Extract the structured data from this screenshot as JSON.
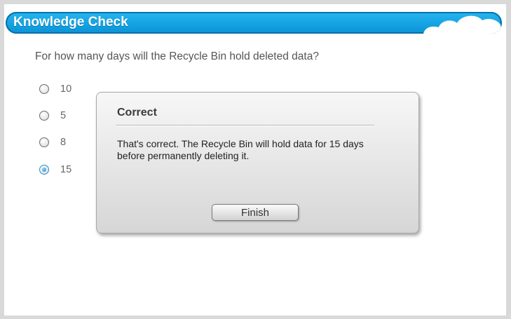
{
  "header": {
    "title": "Knowledge Check"
  },
  "question": "For how many days will the Recycle Bin hold deleted data?",
  "options": [
    {
      "label": "10",
      "selected": false
    },
    {
      "label": "5",
      "selected": false
    },
    {
      "label": "8",
      "selected": false
    },
    {
      "label": "15",
      "selected": true
    }
  ],
  "feedback": {
    "title": "Correct",
    "message": "That's correct. The Recycle Bin will hold data for 15 days before permanently deleting it.",
    "button_label": "Finish"
  },
  "colors": {
    "header_blue": "#0a93d6",
    "selected_radio": "#0c8fd0"
  }
}
